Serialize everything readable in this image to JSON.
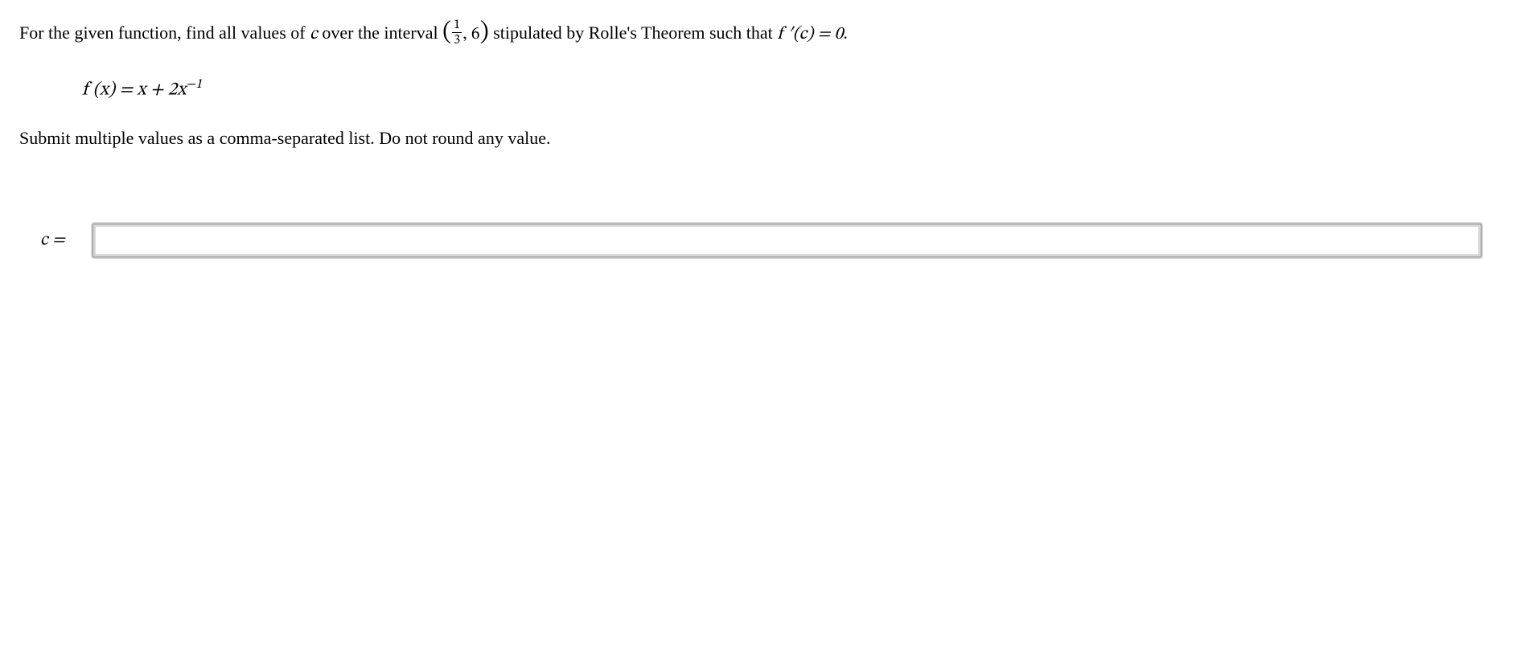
{
  "question": {
    "intro": "For the given function, find all values of ",
    "var_c": "c",
    "over_interval": " over the interval ",
    "interval_open": "(",
    "frac_num": "1",
    "frac_den": "3",
    "interval_rest": ", 6",
    "interval_close": ")",
    "stipulated": " stipulated by Rolle's Theorem such that ",
    "f_prime": "f ′(c) = 0",
    "period": "."
  },
  "function": {
    "lhs": "f (x) = x + 2x",
    "exp": "−1"
  },
  "instruction": "Submit multiple values as a comma-separated list. Do not round any value.",
  "answer": {
    "label_var": "c",
    "label_eq": " =",
    "value": ""
  }
}
